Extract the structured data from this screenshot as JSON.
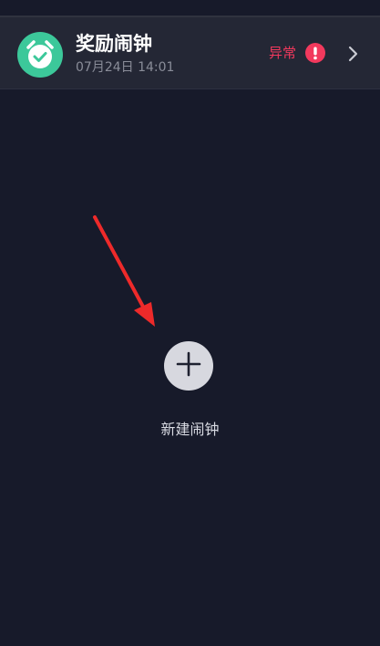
{
  "alarm": {
    "title": "奖励闹钟",
    "time": "07月24日 14:01",
    "status": "异常",
    "icon": "alarm-clock-icon"
  },
  "colors": {
    "background": "#171a2a",
    "row_background": "#242735",
    "icon_green": "#3cc89a",
    "status_red": "#f2395d",
    "arrow_red": "#ee2a2a"
  },
  "actions": {
    "new_alarm_label": "新建闹钟"
  }
}
